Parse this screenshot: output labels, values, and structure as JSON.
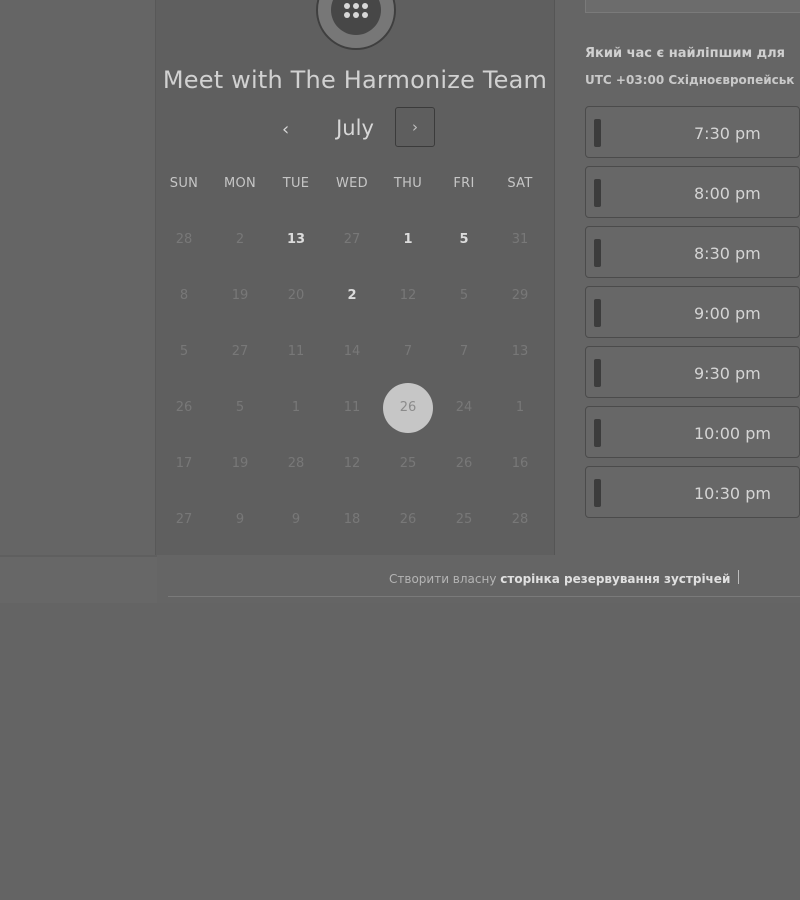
{
  "calendar": {
    "title": "Meet with The Harmonize Team",
    "month": "July",
    "prev_icon": "‹",
    "next_icon": "›",
    "weekdays": [
      "SUN",
      "MON",
      "TUE",
      "WED",
      "THU",
      "FRI",
      "SAT"
    ],
    "days": [
      [
        "28",
        "2",
        "13",
        "27",
        "1",
        "5",
        "31"
      ],
      [
        "8",
        "19",
        "20",
        "2",
        "12",
        "5",
        "29"
      ],
      [
        "5",
        "27",
        "11",
        "14",
        "7",
        "7",
        "13"
      ],
      [
        "26",
        "5",
        "1",
        "11",
        "26",
        "24",
        "1"
      ],
      [
        "17",
        "19",
        "28",
        "12",
        "25",
        "26",
        "16"
      ],
      [
        "27",
        "9",
        "9",
        "18",
        "26",
        "25",
        "28"
      ]
    ],
    "active_days": [
      [
        0,
        2
      ],
      [
        0,
        4
      ],
      [
        0,
        5
      ],
      [
        1,
        3
      ]
    ],
    "selected_day": [
      3,
      4
    ]
  },
  "slots": {
    "question_prefix": "Який час є ",
    "question_link": "найліпшим для ",
    "question_suffix": "",
    "timezone": "UTC +03:00 Східноєвропейськ",
    "times": [
      "7:30 pm",
      "8:00 pm",
      "8:30 pm",
      "9:00 pm",
      "9:30 pm",
      "10:00 pm",
      "10:30 pm"
    ]
  },
  "footer": {
    "prefix": "Створити власну ",
    "link": "сторінка резервування зустрічей"
  }
}
